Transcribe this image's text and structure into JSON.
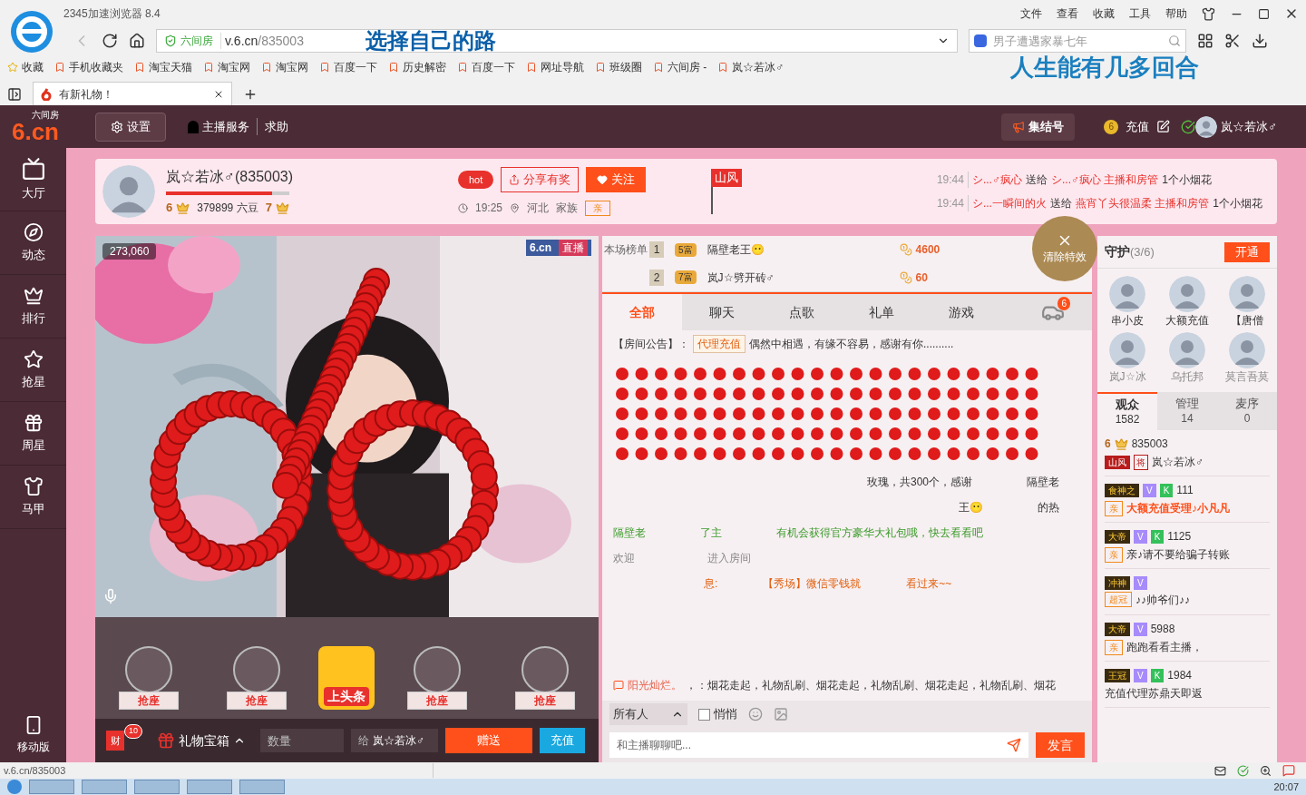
{
  "browser": {
    "title": "2345加速浏览器 8.4",
    "menu": [
      "文件",
      "查看",
      "收藏",
      "工具",
      "帮助"
    ],
    "site_label": "六间房",
    "url_host": "v.6.cn",
    "url_path": "/835003",
    "search_placeholder": "男子遭遇家暴七年",
    "overlay_left": "选择自己的路",
    "overlay_right": "人生能有几多回合",
    "bookmarks": [
      "收藏",
      "手机收藏夹",
      "淘宝天猫",
      "淘宝网",
      "淘宝网",
      "百度一下",
      "历史解密",
      "百度一下",
      "网址导航",
      "班级圈",
      "六间房 -",
      "岚☆若冰♂"
    ],
    "tab": "有新礼物！",
    "status_url": "v.6.cn/835003",
    "clock": "20:07"
  },
  "header": {
    "logo_mark": "6.cn",
    "logo_name": "六间房",
    "settings": "设置",
    "links": [
      "主播服务",
      "求助"
    ],
    "rally": "集结号",
    "coin": "6",
    "recharge": "充值",
    "user": "岚☆若冰♂"
  },
  "nav": [
    "大厅",
    "动态",
    "排行",
    "抢星",
    "周星",
    "马甲"
  ],
  "mobile": "移动版",
  "anchor": {
    "name": "岚☆若冰♂(835003)",
    "level": "6",
    "beans": "379899 六豆",
    "next_level": "7",
    "progress": {
      "level": 0.86
    },
    "hot": "hot",
    "share": "分享有奖",
    "follow": "关注",
    "time": "19:25",
    "location": "河北",
    "family": "家族",
    "family_badge": "亲"
  },
  "flag": "山风",
  "gift_feed": [
    {
      "time": "19:44",
      "from": "シ...♂疯心",
      "verb": "送给",
      "to": "シ...♂疯心 主播和房管",
      "gift": "1个小烟花"
    },
    {
      "time": "19:44",
      "from": "シ...一瞬间的火",
      "verb": "送给",
      "to": "燕宵丫头很温柔 主播和房管",
      "gift": "1个小烟花"
    }
  ],
  "video": {
    "fans": "273,060",
    "logo": "6.cn",
    "live": "直播",
    "seats": [
      {
        "kind": "seat",
        "label": "抢座"
      },
      {
        "kind": "seat",
        "label": "抢座"
      },
      {
        "kind": "headline",
        "label": "上头条"
      },
      {
        "kind": "seat",
        "label": "抢座"
      },
      {
        "kind": "seat",
        "label": "抢座"
      }
    ]
  },
  "ranking": {
    "label": "本场榜单",
    "rows": [
      {
        "rank": "1",
        "badge": "5富",
        "name": "隔壁老王😶",
        "amount": "4600"
      },
      {
        "rank": "2",
        "badge": "7富",
        "name": "岚J☆劈开砖♂",
        "amount": "60"
      }
    ]
  },
  "clear_effects": "清除特效",
  "tabs": [
    {
      "label": "全部",
      "selected": true
    },
    {
      "label": "聊天",
      "selected": false
    },
    {
      "label": "点歌",
      "selected": false
    },
    {
      "label": "礼单",
      "selected": false
    },
    {
      "label": "游戏",
      "selected": false
    }
  ],
  "car_count": "6",
  "notice": {
    "label": "【房间公告】：",
    "tag": "代理充值",
    "text": "偶然中相遇，有缘不容易，感谢有你.........."
  },
  "chat": [
    {
      "kind": "gift",
      "parts": [
        "玫瑰，共300个，感谢",
        "隔壁老"
      ]
    },
    {
      "kind": "gift",
      "parts": [
        "王😶",
        "的热"
      ]
    },
    {
      "kind": "system",
      "parts": [
        "隔壁老",
        "了主",
        "有机会获得官方豪华大礼包哦，快去看看吧"
      ]
    },
    {
      "kind": "enter",
      "parts": [
        "欢迎",
        "进入房间"
      ]
    },
    {
      "kind": "broadcast",
      "parts": [
        "息:",
        "【秀场】微信零钱就",
        "看过来~~"
      ]
    }
  ],
  "ticker": {
    "user": "阳光灿烂。",
    "text": "，：烟花走起，礼物乱刷、烟花走起，礼物乱刷、烟花走起，礼物乱刷、烟花"
  },
  "guard": {
    "title": "守护",
    "count": "(3/6)",
    "open": "开通",
    "members": [
      "串小皮",
      "大额充值",
      "【唐僧",
      "岚J☆冰",
      "乌托邦",
      "莫言吾莫"
    ]
  },
  "audience_tabs": [
    {
      "label": "观众",
      "count": "1582",
      "selected": true
    },
    {
      "label": "管理",
      "count": "14",
      "selected": false
    },
    {
      "label": "麦序",
      "count": "0",
      "selected": false
    }
  ],
  "audience": [
    {
      "level": "6",
      "id": "835003",
      "tag": "山风",
      "rank": "将",
      "line2": "岚☆若冰♂"
    },
    {
      "badge": "食神之",
      "marks": [
        "V",
        "K"
      ],
      "id": "111",
      "tag": "亲",
      "line2": "大额充值受理♪小凡凡"
    },
    {
      "badge": "大帝",
      "marks": [
        "V",
        "K"
      ],
      "id": "1125",
      "tag": "亲",
      "line2": "亲♪请不要给骗子转账"
    },
    {
      "badge": "冲神",
      "marks": [
        "V"
      ],
      "tag": "超冠",
      "line2": "♪♪帅爷们♪♪"
    },
    {
      "badge": "大帝",
      "marks": [
        "V"
      ],
      "id": "5988",
      "tag": "亲",
      "line2": "跑跑看看主播，"
    },
    {
      "badge": "王冠",
      "marks": [
        "V",
        "K"
      ],
      "id": "1984",
      "line2": "充值代理苏鼎天即返"
    }
  ],
  "gift_bar": {
    "wealth_count": "10",
    "wealth": "财",
    "box": "礼物宝箱",
    "qty_placeholder": "数量",
    "to_label": "给",
    "to": "岚☆若冰♂",
    "send": "赠送",
    "recharge": "充值"
  },
  "chat_input": {
    "target": "所有人",
    "whisper": "悄悄",
    "whisper_checked": false,
    "placeholder": "和主播聊聊吧...",
    "send": "发言"
  }
}
